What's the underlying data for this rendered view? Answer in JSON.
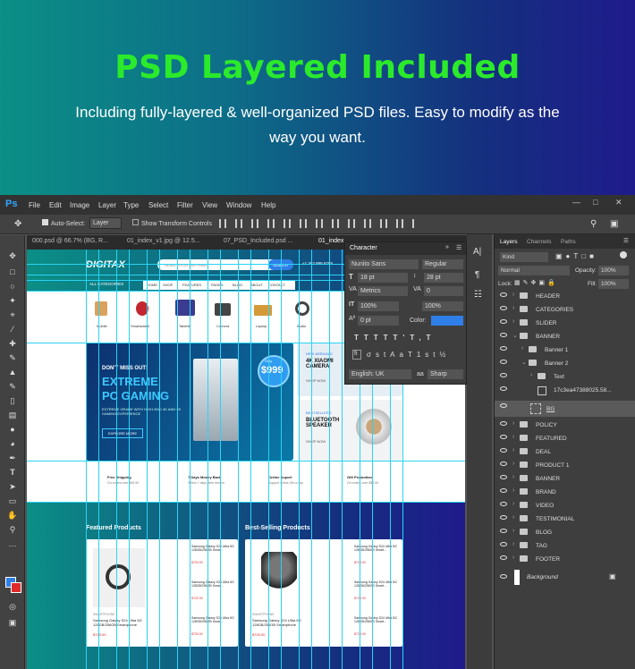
{
  "hero": {
    "title": "PSD Layered Included",
    "subtitle": "Including fully-layered & well-organized PSD files.  Easy to modify as the way you want."
  },
  "app": {
    "logo": "Ps",
    "menu": [
      "File",
      "Edit",
      "Image",
      "Layer",
      "Type",
      "Select",
      "Filter",
      "View",
      "Window",
      "Help"
    ]
  },
  "options": {
    "auto_select_label": "Auto-Select:",
    "auto_select_value": "Layer",
    "transform_label": "Show Transform Controls"
  },
  "tabs": [
    "000.psd @ 66.7% (BG, R...",
    "01_index_v1.jpg @ 12.5...",
    "07_PSD_Included.psd ...",
    "01_index"
  ],
  "character": {
    "title": "Character",
    "font": "Nunito Sans",
    "style": "Regular",
    "size": "18 pt",
    "leading": "28 pt",
    "kerning": "Metrics",
    "tracking": "0",
    "vscale": "100%",
    "hscale": "100%",
    "baseline": "0 pt",
    "color_label": "Color:",
    "language": "English: UK",
    "aa": "Sharp",
    "aa_label": "aa",
    "accent": "#2f7fe8"
  },
  "layers_panel": {
    "tabs": [
      "Layers",
      "Channels",
      "Paths"
    ],
    "kind": "Kind",
    "blend": "Normal",
    "opacity_label": "Opacity:",
    "opacity": "100%",
    "lock_label": "Lock:",
    "fill_label": "Fill:",
    "fill": "100%",
    "items": [
      "HEADER",
      "CATEGORIES",
      "SLIDER",
      "BANNER",
      "Banner 1",
      "Banner 2",
      "Text",
      "17c3ea47388025.58...",
      "BG",
      "POLICY",
      "FEATURED",
      "DEAL",
      "PRODUCT 1",
      "BANNER",
      "BRAND",
      "VIDEO",
      "TESTIMONIAL",
      "BLOG",
      "TAG",
      "FOOTER",
      "Background"
    ]
  },
  "site": {
    "logo": "DIGITAX",
    "search_placeholder": "SEARCH FOR ANYTHING",
    "search_btn": "SEARCH",
    "phone": "+1 362 888 6789",
    "all_categories": "ALL CATEGORIES",
    "nav": [
      "HOME",
      "SHOP",
      "FEATURES",
      "PAGES",
      "BLOG",
      "ABOUT",
      "CONTACT"
    ],
    "categories": [
      "Mobile",
      "Smartwatch",
      "Tablets",
      "Camera",
      "Laptop",
      "Audio"
    ],
    "banner": {
      "kicker": "DON'T MISS OUT!",
      "title1": "EXTREME",
      "title2": "PC GAMING",
      "desc": "EXTREME GRADE WITH HIGH-END 4K AND 9X GAMING EXPERIENCE",
      "btn": "EXPLORE MORE",
      "price": "$999",
      "price_label": "Only"
    },
    "side1": {
      "kicker": "NEW ARRIVALS",
      "title": "4K XIAOMI CAMERA",
      "btn": "SHOP NOW"
    },
    "side2": {
      "kicker": "BESTSELLERS",
      "title": "BLUETOOTH SPEAKER",
      "btn": "SHOP NOW"
    },
    "policies": [
      {
        "t": "Free Shipping",
        "d": "On orders over $49.90"
      },
      {
        "t": "7 Days Money Back",
        "d": "Within 7 days, free returns"
      },
      {
        "t": "Online Suport",
        "d": "Support online 24h a day"
      },
      {
        "t": "Gift Promotion",
        "d": "On orders over $59.00"
      }
    ],
    "featured": "Featured Products",
    "bestselling": "Best-Selling Products",
    "product_title": "Samsung Galaxy S24 Ultra 5G 128GB/256GB Smart...",
    "price": "$720.00",
    "old": "$890.00",
    "brand": "SMARTPHONE",
    "main_product": "Samsung Galaxy S24 Ultra 5G 128GB/256GB Smartphone",
    "main_price": "$729.00"
  }
}
